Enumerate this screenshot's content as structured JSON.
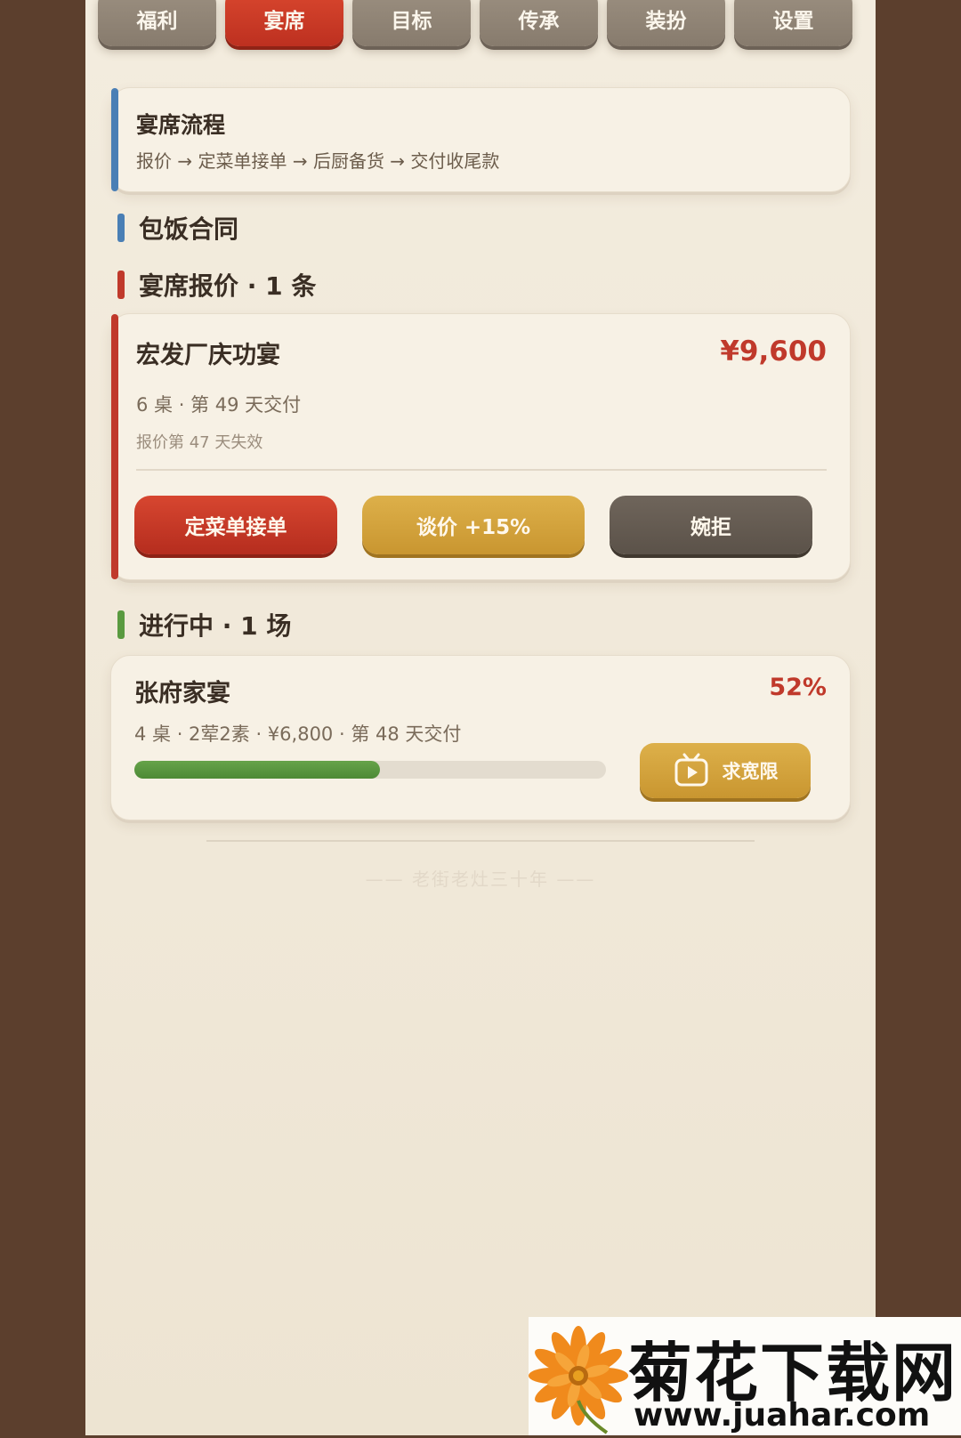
{
  "tabs": [
    {
      "label": "福利"
    },
    {
      "label": "宴席"
    },
    {
      "label": "目标"
    },
    {
      "label": "传承"
    },
    {
      "label": "装扮"
    },
    {
      "label": "设置"
    }
  ],
  "active_tab": "宴席",
  "flow": {
    "title": "宴席流程",
    "steps": "报价 → 定菜单接单 → 后厨备货 → 交付收尾款"
  },
  "sections": {
    "contract": "包饭合同",
    "quotes": "宴席报价 · 1 条",
    "in_progress": "进行中 · 1 场"
  },
  "quote": {
    "name": "宏发厂庆功宴",
    "price": "¥9,600",
    "detail": "6 桌 · 第 49 天交付",
    "expires": "报价第 47 天失效",
    "accept_label": "定菜单接单",
    "negotiate_label": "谈价 +15%",
    "decline_label": "婉拒"
  },
  "progress_item": {
    "name": "张府家宴",
    "percent_label": "52%",
    "progress": 0.52,
    "detail": "4 桌 · 2荤2素 · ¥6,800 · 第 48 天交付",
    "grace_label": "求宽限"
  },
  "footer": "—— 老街老灶三十年 ——",
  "watermark": {
    "title": "菊花下载网",
    "url": "www.juahar.com"
  },
  "colors": {
    "accent_red": "#c0392b",
    "accent_gold": "#d4a43c",
    "progress_green": "#5a9a40",
    "flow_blue": "#4a7fb5",
    "background_brown": "#5c3f2d"
  }
}
